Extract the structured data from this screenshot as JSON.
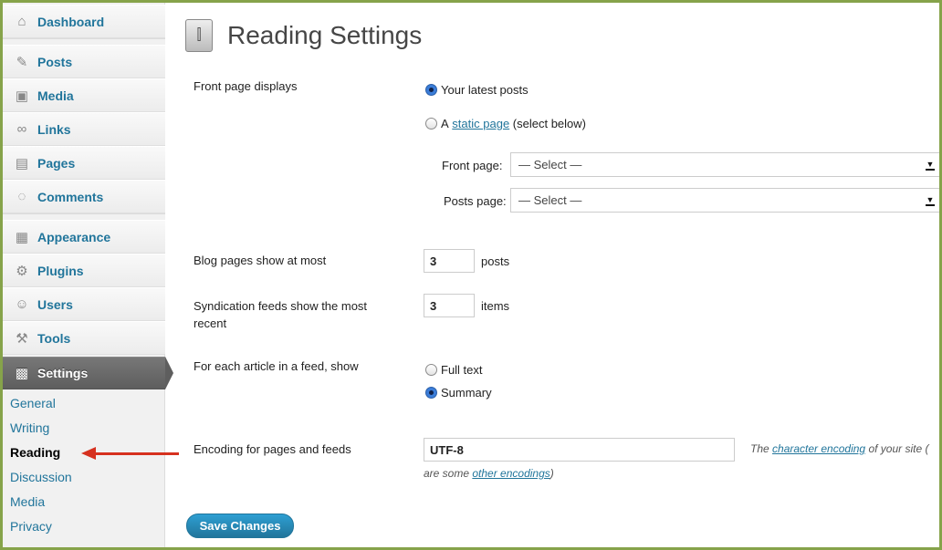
{
  "sidebar": {
    "items": [
      {
        "label": "Dashboard",
        "icon": "home-icon",
        "glyph": "⌂"
      },
      {
        "label": "Posts",
        "icon": "pushpin-icon",
        "glyph": "✎"
      },
      {
        "label": "Media",
        "icon": "media-icon",
        "glyph": "▣"
      },
      {
        "label": "Links",
        "icon": "link-icon",
        "glyph": "∞"
      },
      {
        "label": "Pages",
        "icon": "pages-icon",
        "glyph": "▤"
      },
      {
        "label": "Comments",
        "icon": "comment-icon",
        "glyph": "◌"
      },
      {
        "label": "Appearance",
        "icon": "appearance-icon",
        "glyph": "▦"
      },
      {
        "label": "Plugins",
        "icon": "plugin-icon",
        "glyph": "⚙"
      },
      {
        "label": "Users",
        "icon": "users-icon",
        "glyph": "☺"
      },
      {
        "label": "Tools",
        "icon": "tools-icon",
        "glyph": "⚒"
      },
      {
        "label": "Settings",
        "icon": "settings-icon",
        "glyph": "▩"
      }
    ],
    "submenu": [
      "General",
      "Writing",
      "Reading",
      "Discussion",
      "Media",
      "Privacy"
    ]
  },
  "page": {
    "title": "Reading Settings"
  },
  "front_page": {
    "label": "Front page displays",
    "option_latest": "Your latest posts",
    "option_static_prefix": "A",
    "option_static_link": "static page",
    "option_static_suffix": "(select below)",
    "front_page_label": "Front page:",
    "front_page_value": "— Select —",
    "posts_page_label": "Posts page:",
    "posts_page_value": "— Select —"
  },
  "blog_pages": {
    "label": "Blog pages show at most",
    "value": "3",
    "unit": "posts"
  },
  "syndication": {
    "label_line1": "Syndication feeds show the most",
    "label_line2": "recent",
    "value": "3",
    "unit": "items"
  },
  "feed_article": {
    "label": "For each article in a feed, show",
    "option_full": "Full text",
    "option_summary": "Summary"
  },
  "encoding": {
    "label": "Encoding for pages and feeds",
    "value": "UTF-8",
    "desc_prefix": "The",
    "desc_link": "character encoding",
    "desc_suffix": "of your site (",
    "desc2_prefix": "are some",
    "desc2_link": "other encodings",
    "desc2_suffix": ")"
  },
  "save_label": "Save Changes",
  "colors": {
    "frame": "#86a34a",
    "link": "#21759b",
    "annotation": "#d6311f"
  }
}
